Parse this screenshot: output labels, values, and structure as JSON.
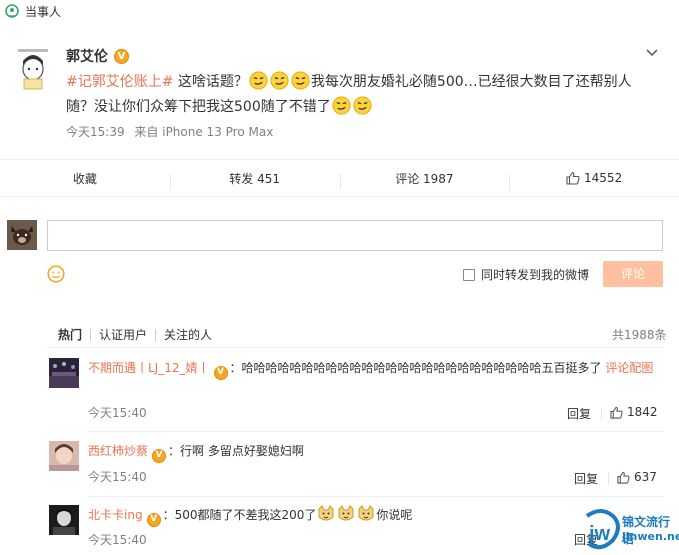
{
  "tag": {
    "label": "当事人",
    "icon": "location-pin-icon"
  },
  "post": {
    "author": "郭艾伦",
    "verified_badge": "V",
    "topic": "#记郭艾伦账上#",
    "text_part1": " 这啥话题？",
    "text_part2": "我每次朋友婚礼必随500…已经很大数目了还帮别人随？没让你们众筹下把我这500随了不错了",
    "time": "今天15:39",
    "source": "来自 iPhone 13 Pro Max"
  },
  "actions": {
    "favorite": "收藏",
    "repost": "转发 451",
    "comment": "评论 1987",
    "likes": "14552"
  },
  "composer": {
    "repost_option": "同时转发到我的微博",
    "submit": "评论"
  },
  "comment_tabs": {
    "hot": "热门",
    "verified": "认证用户",
    "following": "关注的人",
    "total": "共1988条"
  },
  "comments": [
    {
      "user": "不期而遇丨LJ_12_婧丨",
      "badge": "V",
      "text": "：哈哈哈哈哈哈哈哈哈哈哈哈哈哈哈哈哈哈哈哈哈哈哈哈哈五百挺多了",
      "more": "评论配图",
      "time": "今天15:40",
      "reply": "回复",
      "likes": "1842"
    },
    {
      "user": "西红柿炒蔡",
      "badge": "V",
      "text": "：行啊 多留点好娶媳妇啊",
      "time": "今天15:40",
      "reply": "回复",
      "likes": "637"
    },
    {
      "user": "北卡卡ing",
      "badge": "V",
      "text_part1": "：500都随了不差我这200了",
      "text_part2": "你说呢",
      "time": "今天15:40",
      "reply": "回复"
    }
  ],
  "watermark": {
    "line1": "锦文流行语",
    "line2": "jinwen.net"
  },
  "colors": {
    "accent": "#eb7350",
    "badge": "#f5a623",
    "submit_disabled": "#ffc09f",
    "watermark": "#1a7dc0"
  }
}
